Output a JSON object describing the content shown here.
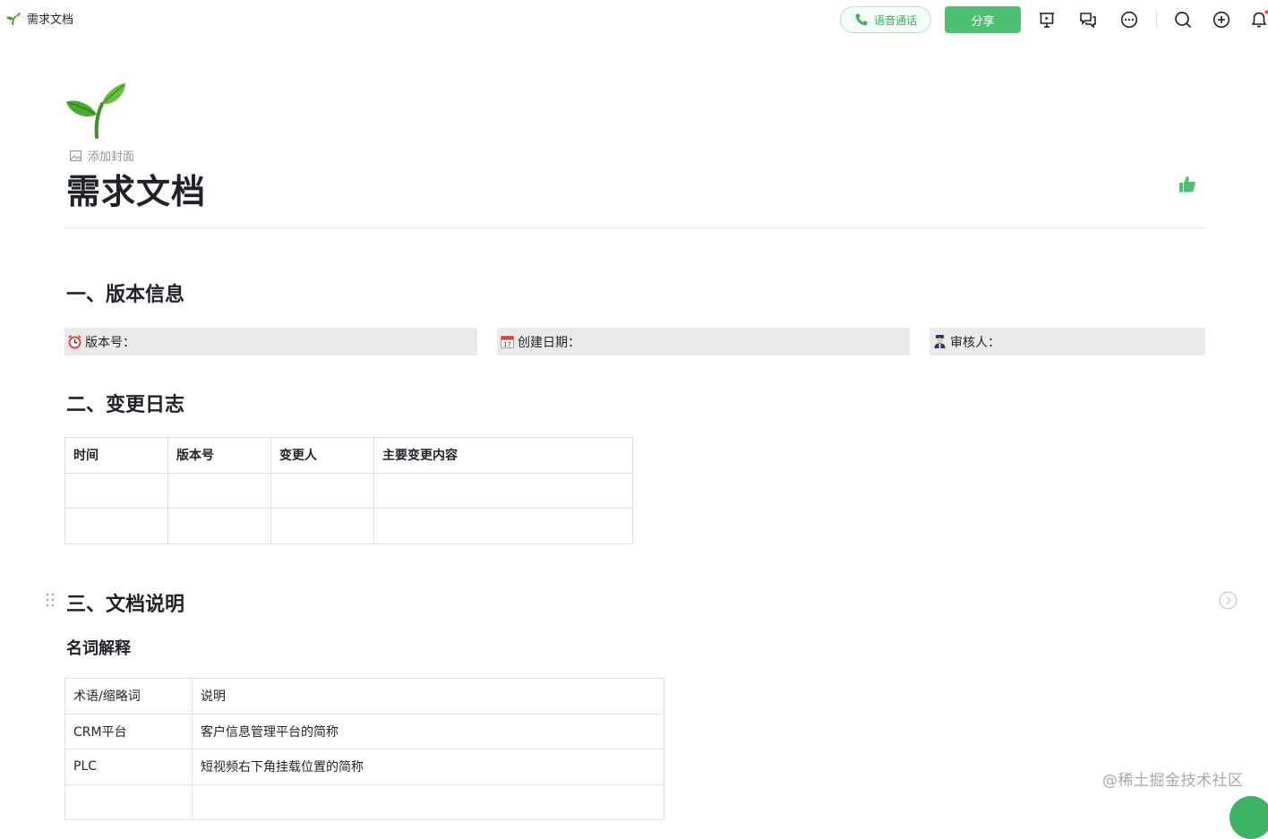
{
  "topbar": {
    "doc_title": "需求文档",
    "voice_call_label": "语音通话",
    "share_label": "分享"
  },
  "header": {
    "add_cover_label": "添加封面",
    "title": "需求文档"
  },
  "section1": {
    "heading": "一、版本信息",
    "fields": [
      {
        "icon": "alarm-clock-icon",
        "label": "版本号："
      },
      {
        "icon": "calendar-icon",
        "label": "创建日期："
      },
      {
        "icon": "reviewer-icon",
        "label": "审核人："
      }
    ]
  },
  "section2": {
    "heading": "二、变更日志",
    "columns": [
      "时间",
      "版本号",
      "变更人",
      "主要变更内容"
    ],
    "rows": [
      [
        "",
        "",
        "",
        ""
      ],
      [
        "",
        "",
        "",
        ""
      ]
    ]
  },
  "section3": {
    "heading": "三、文档说明",
    "subheading": "名词解释",
    "glossary": [
      [
        "术语/缩略词",
        "说明"
      ],
      [
        "CRM平台",
        "客户信息管理平台的简称"
      ],
      [
        "PLC",
        "短视频右下角挂载位置的简称"
      ],
      [
        "",
        ""
      ]
    ]
  },
  "watermark": "@稀土掘金技术社区",
  "colors": {
    "brand_green": "#4fbf72",
    "voice_green": "#3bb363",
    "text": "#1f2329",
    "muted": "#8f959e",
    "info_box_bg": "#eaeaea",
    "border": "#dee0e3"
  }
}
